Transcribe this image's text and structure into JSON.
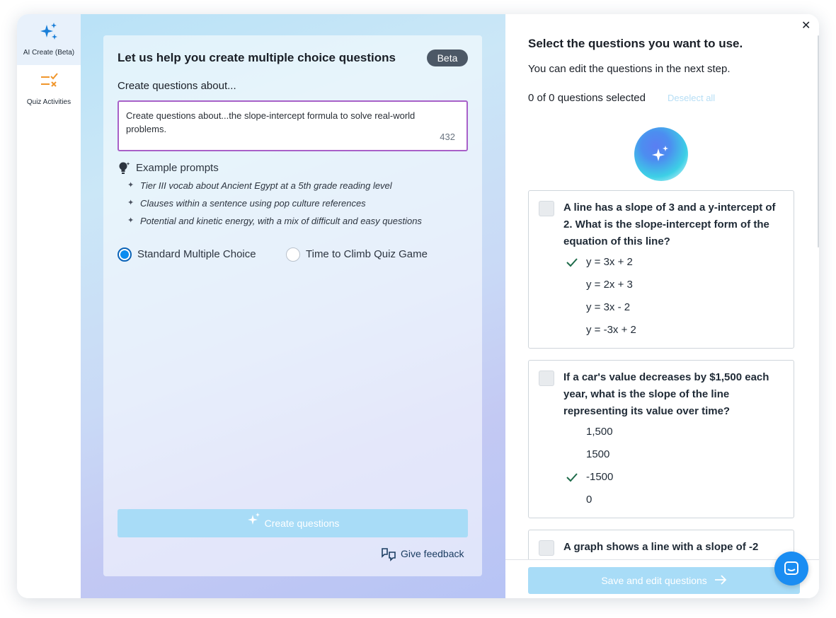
{
  "sidebar": {
    "items": [
      {
        "label": "AI Create (Beta)",
        "icon": "sparkles-icon"
      },
      {
        "label": "Quiz Activities",
        "icon": "checklist-icon"
      }
    ]
  },
  "left": {
    "title": "Let us help you create multiple choice questions",
    "badge": "Beta",
    "about_label": "Create questions about...",
    "input_value": "Create questions about...the slope-intercept formula to solve real-world problems.",
    "char_count": "432",
    "examples_heading": "Example prompts",
    "examples": [
      "Tier III vocab about Ancient Egypt at a 5th grade reading level",
      "Clauses within a sentence using pop culture references",
      "Potential and kinetic energy, with a mix of difficult and easy questions"
    ],
    "mode_options": [
      {
        "label": "Standard Multiple Choice",
        "selected": true
      },
      {
        "label": "Time to Climb Quiz Game",
        "selected": false
      }
    ],
    "create_button": "Create questions",
    "feedback_link": "Give feedback"
  },
  "right": {
    "title": "Select the questions you want to use.",
    "subtitle": "You can edit the questions in the next step.",
    "selected_count": "0 of 0 questions selected",
    "deselect_all": "Deselect all",
    "questions": [
      {
        "text": "A line has a slope of 3 and a y-intercept of 2. What is the slope-intercept form of the equation of this line?",
        "answers": [
          "y = 3x + 2",
          "y = 2x + 3",
          "y = 3x - 2",
          "y = -3x + 2"
        ],
        "correct_index": 0
      },
      {
        "text": "If a car's value decreases by $1,500 each year, what is the slope of the line representing its value over time?",
        "answers": [
          "1,500",
          "1500",
          "-1500",
          "0"
        ],
        "correct_index": 2
      },
      {
        "text": "A graph shows a line with a slope of -2",
        "answers": [],
        "correct_index": -1
      }
    ],
    "save_button": "Save and edit questions"
  },
  "colors": {
    "accent": "#0a8cf0",
    "textarea_border": "#a860c8",
    "disabled_button": "#a8dcf7",
    "check": "#1e6b4a",
    "badge": "#4c5866"
  }
}
